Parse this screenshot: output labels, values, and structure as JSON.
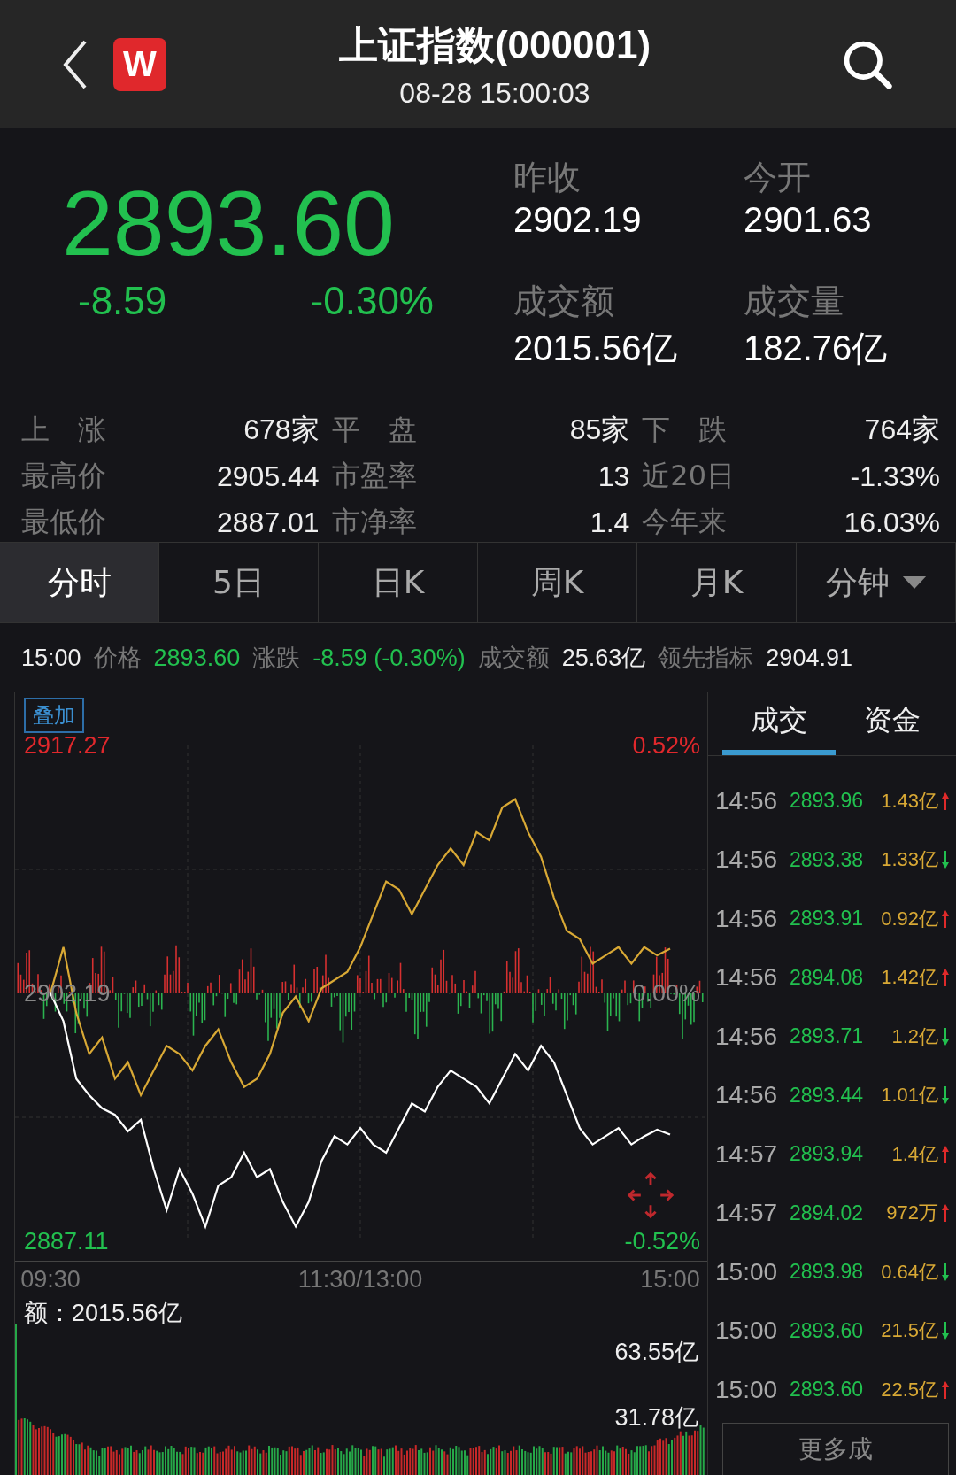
{
  "header": {
    "title": "上证指数(000001)",
    "subtitle": "08-28 15:00:03",
    "logo": "W"
  },
  "quote": {
    "price": "2893.60",
    "change": "-8.59",
    "change_pct": "-0.30%",
    "rising": false,
    "fields": [
      {
        "label": "昨收",
        "value": "2902.19"
      },
      {
        "label": "今开",
        "value": "2901.63"
      },
      {
        "label": "成交额",
        "value": "2015.56亿"
      },
      {
        "label": "成交量",
        "value": "182.76亿"
      }
    ]
  },
  "stats": [
    {
      "label": "上　涨",
      "value": "678家"
    },
    {
      "label": "平　盘",
      "value": "85家"
    },
    {
      "label": "下　跌",
      "value": "764家"
    },
    {
      "label": "最高价",
      "value": "2905.44"
    },
    {
      "label": "市盈率",
      "value": "13"
    },
    {
      "label": "近20日",
      "value": "-1.33%"
    },
    {
      "label": "最低价",
      "value": "2887.01"
    },
    {
      "label": "市净率",
      "value": "1.4"
    },
    {
      "label": "今年来",
      "value": "16.03%"
    }
  ],
  "tabs": [
    {
      "label": "分时",
      "selected": true
    },
    {
      "label": "5日",
      "selected": false
    },
    {
      "label": "日K",
      "selected": false
    },
    {
      "label": "周K",
      "selected": false
    },
    {
      "label": "月K",
      "selected": false
    },
    {
      "label": "分钟",
      "selected": false,
      "dropdown": true
    }
  ],
  "info_line": {
    "time": "15:00",
    "price_label": "价格",
    "price": "2893.60",
    "change_label": "涨跌",
    "change": "-8.59 (-0.30%)",
    "amount_label": "成交额",
    "amount": "25.63亿",
    "lead_label": "领先指标",
    "lead": "2904.91"
  },
  "chart": {
    "overlay_button": "叠加",
    "high_pct": "0.52%",
    "mid_pct": "0.00%",
    "low_pct": "-0.52%",
    "chart_data": {
      "type": "line",
      "ylim": [
        2887.11,
        2917.27
      ],
      "yticks": [
        {
          "value": 2917.27,
          "label": "2917.27"
        },
        {
          "value": 2902.19,
          "label": "2902.19"
        },
        {
          "value": 2887.11,
          "label": "2887.11"
        }
      ],
      "categories": [
        "09:30",
        null,
        null,
        null,
        null,
        null,
        null,
        null,
        null,
        null,
        null,
        null,
        null,
        null,
        null,
        null,
        null,
        null,
        null,
        null,
        null,
        null,
        null,
        null,
        "11:30/13:00",
        null,
        null,
        null,
        null,
        null,
        null,
        null,
        null,
        null,
        null,
        null,
        null,
        null,
        null,
        null,
        null,
        null,
        null,
        null,
        null,
        null,
        null,
        null,
        "15:00"
      ],
      "series": [
        {
          "color": "#d9a935",
          "values": [
            2902.2,
            2905.0,
            2901.0,
            2898.5,
            2899.5,
            2897.0,
            2898.0,
            2896.0,
            2897.5,
            2899.0,
            2898.5,
            2897.5,
            2899.0,
            2900.0,
            2898.0,
            2896.5,
            2897.0,
            2898.5,
            2901.0,
            2902.0,
            2900.5,
            2902.5,
            2903.0,
            2903.5,
            2905.0,
            2907.0,
            2909.0,
            2908.5,
            2907.0,
            2908.5,
            2910.0,
            2911.0,
            2910.0,
            2912.0,
            2911.5,
            2913.5,
            2914.0,
            2912.0,
            2910.5,
            2908.0,
            2906.0,
            2905.5,
            2904.0,
            2904.5,
            2905.0,
            2904.0,
            2905.0,
            2904.5,
            2904.91
          ]
        },
        {
          "color": "#ffffff",
          "values": [
            2902.2,
            2900.5,
            2897.0,
            2896.0,
            2895.2,
            2894.8,
            2893.8,
            2894.5,
            2891.5,
            2889.0,
            2891.5,
            2890.0,
            2888.0,
            2890.5,
            2891.0,
            2892.5,
            2891.0,
            2891.5,
            2889.5,
            2888.0,
            2889.5,
            2892.0,
            2893.5,
            2893.0,
            2894.0,
            2893.0,
            2892.5,
            2894.0,
            2895.5,
            2895.0,
            2896.5,
            2897.5,
            2897.0,
            2896.5,
            2895.5,
            2897.0,
            2898.5,
            2897.5,
            2899.0,
            2898.0,
            2896.0,
            2894.0,
            2893.0,
            2893.5,
            2894.0,
            2893.0,
            2893.5,
            2893.9,
            2893.6
          ]
        }
      ]
    },
    "volume_label": "额：2015.56亿",
    "volume_high": "63.55亿",
    "volume_mid": "31.78亿"
  },
  "trade_panel": {
    "tabs": [
      {
        "label": "成交",
        "selected": true
      },
      {
        "label": "资金",
        "selected": false
      }
    ],
    "trades": [
      {
        "time": "14:56",
        "price": "2893.96",
        "amount": "1.43亿",
        "up": true
      },
      {
        "time": "14:56",
        "price": "2893.38",
        "amount": "1.33亿",
        "up": false
      },
      {
        "time": "14:56",
        "price": "2893.91",
        "amount": "0.92亿",
        "up": true
      },
      {
        "time": "14:56",
        "price": "2894.08",
        "amount": "1.42亿",
        "up": true
      },
      {
        "time": "14:56",
        "price": "2893.71",
        "amount": "1.2亿",
        "up": false
      },
      {
        "time": "14:56",
        "price": "2893.44",
        "amount": "1.01亿",
        "up": false
      },
      {
        "time": "14:57",
        "price": "2893.94",
        "amount": "1.4亿",
        "up": true
      },
      {
        "time": "14:57",
        "price": "2894.02",
        "amount": "972万",
        "up": true
      },
      {
        "time": "15:00",
        "price": "2893.98",
        "amount": "0.64亿",
        "up": false
      },
      {
        "time": "15:00",
        "price": "2893.60",
        "amount": "21.5亿",
        "up": false
      },
      {
        "time": "15:00",
        "price": "2893.60",
        "amount": "22.5亿",
        "up": true
      }
    ],
    "more_button": "更多成"
  }
}
